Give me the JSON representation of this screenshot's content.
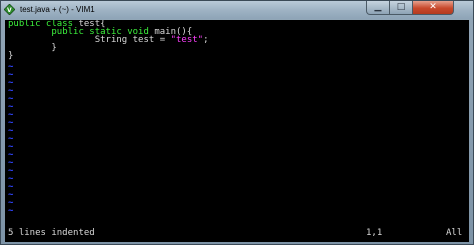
{
  "window": {
    "title": "test.java + (~) - VIM1",
    "minimize_glyph": "▁",
    "maximize_glyph": "□",
    "close_glyph": "✕"
  },
  "icons": {
    "app": "vim-icon"
  },
  "editor": {
    "lines": [
      {
        "parts": [
          {
            "cls": "kw",
            "text": "public class "
          },
          {
            "cls": "plain",
            "text": "test{"
          }
        ]
      },
      {
        "parts": [
          {
            "cls": "plain",
            "text": "        "
          },
          {
            "cls": "kw",
            "text": "public static void "
          },
          {
            "cls": "plain",
            "text": "main(){"
          }
        ]
      },
      {
        "parts": [
          {
            "cls": "plain",
            "text": "                String test = "
          },
          {
            "cls": "str",
            "text": "\"test\""
          },
          {
            "cls": "plain",
            "text": ";"
          }
        ]
      },
      {
        "parts": [
          {
            "cls": "plain",
            "text": "        }"
          }
        ]
      },
      {
        "parts": [
          {
            "cls": "plain",
            "text": "}"
          }
        ]
      }
    ],
    "tilde": "~",
    "tilde_count": 19
  },
  "status": {
    "message": "5 lines indented",
    "position": "1,1",
    "scroll": "All"
  },
  "colors": {
    "keyword": "#3cf03c",
    "string": "#ff40ff",
    "tilde": "#2f45ff",
    "background": "#000000"
  }
}
